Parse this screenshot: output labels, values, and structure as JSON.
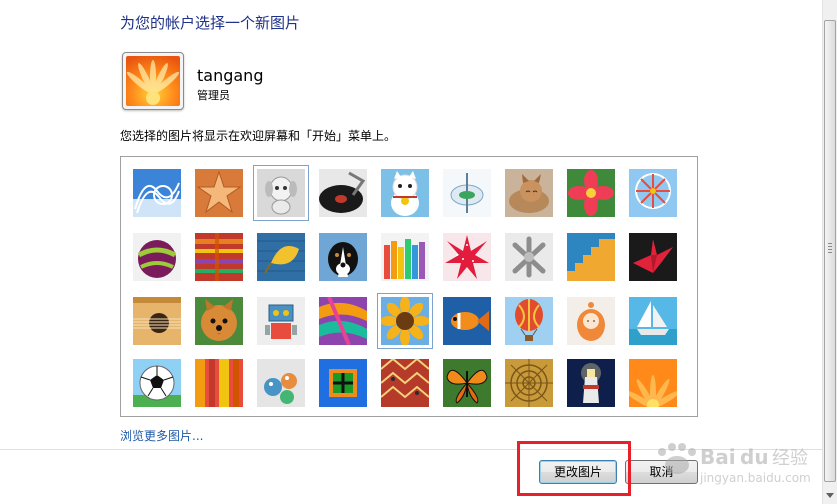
{
  "dialog": {
    "heading": "为您的帐户选择一个新图片",
    "user": {
      "name": "tangang",
      "role": "管理员"
    },
    "description": "您选择的图片将显示在欢迎屏幕和「开始」菜单上。",
    "browse_link": "浏览更多图片...",
    "buttons": {
      "change": "更改图片",
      "cancel": "取消"
    }
  },
  "pictures": [
    {
      "name": "roller-coaster",
      "selected": false
    },
    {
      "name": "starfish",
      "selected": false
    },
    {
      "name": "robot-dog",
      "selected": true
    },
    {
      "name": "record-player",
      "selected": false
    },
    {
      "name": "lucky-cat",
      "selected": false
    },
    {
      "name": "spinning-top",
      "selected": false
    },
    {
      "name": "kitten",
      "selected": false
    },
    {
      "name": "red-flower",
      "selected": false
    },
    {
      "name": "ferris-wheel",
      "selected": false
    },
    {
      "name": "ball",
      "selected": false
    },
    {
      "name": "fabric",
      "selected": false
    },
    {
      "name": "leaf",
      "selected": false
    },
    {
      "name": "dog",
      "selected": false
    },
    {
      "name": "crayons",
      "selected": false
    },
    {
      "name": "paper-star",
      "selected": false
    },
    {
      "name": "jacks",
      "selected": false
    },
    {
      "name": "stairs",
      "selected": false
    },
    {
      "name": "paper-crane",
      "selected": false
    },
    {
      "name": "guitar",
      "selected": false
    },
    {
      "name": "pomeranian",
      "selected": false
    },
    {
      "name": "toy-robot",
      "selected": false
    },
    {
      "name": "scarf",
      "selected": false
    },
    {
      "name": "sunflower",
      "selected": true
    },
    {
      "name": "fish",
      "selected": false
    },
    {
      "name": "hot-air-balloon",
      "selected": false
    },
    {
      "name": "doll",
      "selected": false
    },
    {
      "name": "sailboat",
      "selected": false
    },
    {
      "name": "soccer-ball",
      "selected": false
    },
    {
      "name": "stripes",
      "selected": false
    },
    {
      "name": "marbles",
      "selected": false
    },
    {
      "name": "window",
      "selected": false
    },
    {
      "name": "rug",
      "selected": false
    },
    {
      "name": "butterfly",
      "selected": false
    },
    {
      "name": "basket",
      "selected": false
    },
    {
      "name": "lighthouse",
      "selected": false
    },
    {
      "name": "orange-flower",
      "selected": false
    }
  ],
  "watermark": {
    "brand": "Baidu",
    "brand_cn": "经验",
    "url": "jingyan.baidu.com"
  },
  "colors": {
    "heading": "#1e3287",
    "link": "#1e5aa8",
    "highlight": "#e8202a"
  }
}
